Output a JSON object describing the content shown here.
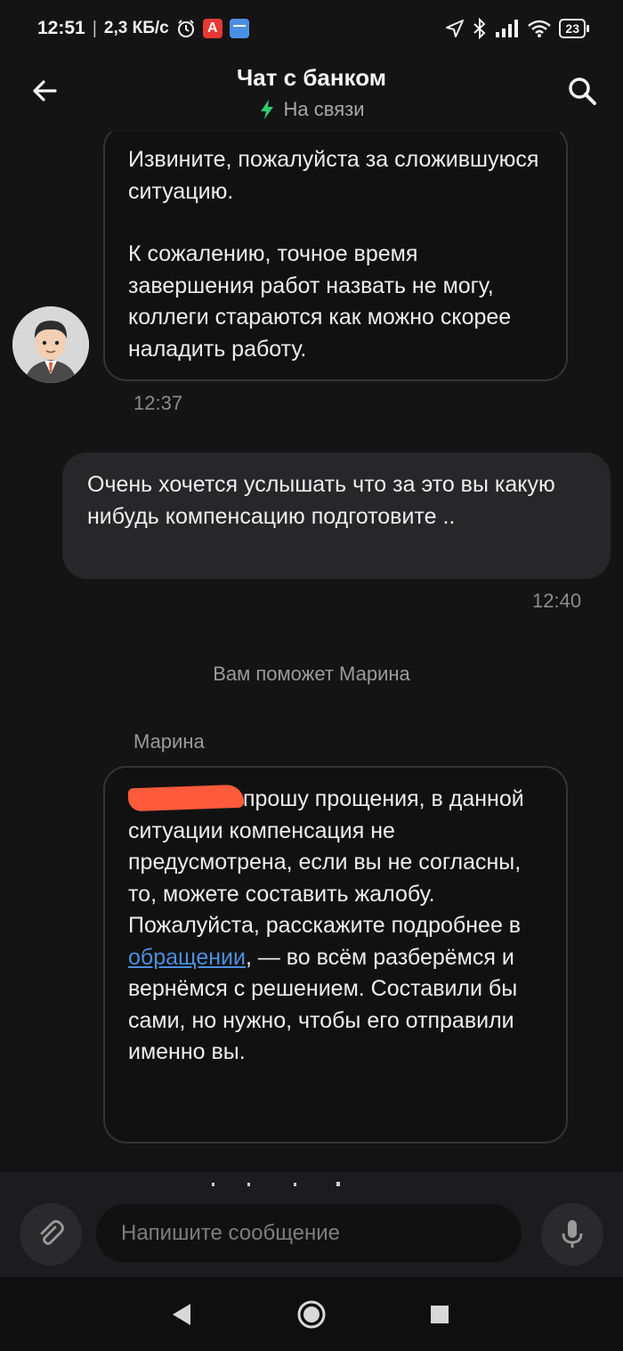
{
  "status_bar": {
    "time": "12:51",
    "separator": "|",
    "speed": "2,3 КБ/с",
    "app_badge": "А",
    "battery": "23"
  },
  "header": {
    "title": "Чат с банком",
    "status": "На связи",
    "status_color": "#2ecc71"
  },
  "messages": {
    "bank_1": {
      "paragraph1": "Извините, пожалуйста за сложившуюся ситуацию.",
      "paragraph2": "К сожалению, точное время завершения работ назвать не могу, коллеги стараются как можно скорее наладить работу.",
      "time": "12:37"
    },
    "user_1": {
      "text": "Очень хочется услышать что за это вы какую нибудь компенсацию подготовите ..",
      "time": "12:40"
    },
    "system_note": "Вам поможет Марина",
    "operator": {
      "name": "Марина",
      "text_part1": "прошу прощения, в данной ситуации компенсация не предусмотрена, если вы не согласны, то, можете составить жалобу.",
      "text_part2": "Пожалуйста, расскажите подробнее в",
      "link": "обращении",
      "text_part3": ", — во всём разберёмся и вернёмся с решением. Составили бы сами, но нужно, чтобы его отправили именно вы."
    }
  },
  "composer": {
    "placeholder": "Напишите сообщение"
  },
  "icons": {
    "back": "arrow-left-icon",
    "search": "search-icon",
    "attach": "paperclip-icon",
    "mic": "microphone-icon",
    "status": "lightning-icon"
  },
  "colors": {
    "background": "#141414",
    "link": "#4c8fdf",
    "redaction": "#ff5a3c"
  }
}
